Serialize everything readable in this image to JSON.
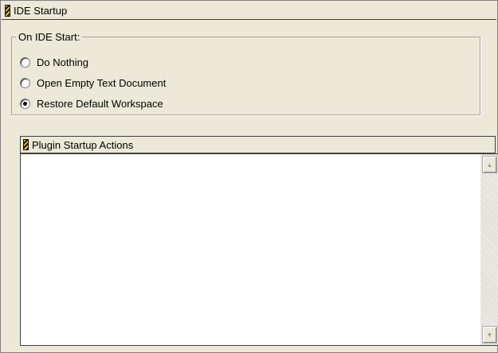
{
  "panel": {
    "title": "IDE Startup"
  },
  "on_start": {
    "legend": "On IDE Start:",
    "options": [
      {
        "label": "Do Nothing",
        "checked": false
      },
      {
        "label": "Open Empty Text Document",
        "checked": false
      },
      {
        "label": "Restore Default Workspace",
        "checked": true
      }
    ]
  },
  "plugins": {
    "header": "Plugin Startup Actions",
    "items": []
  },
  "icons": {
    "grip": "drag-grip-icon",
    "scroll_up": "scroll-up-arrow-icon",
    "scroll_down": "scroll-down-arrow-icon"
  },
  "colors": {
    "window_bg": "#ece9d8",
    "grip_yellow": "#f0c800",
    "list_bg": "#ffffff"
  }
}
